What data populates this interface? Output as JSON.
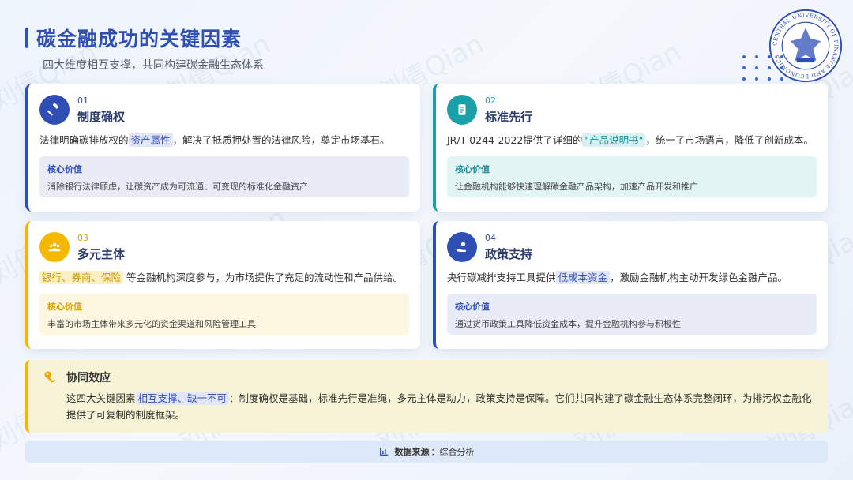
{
  "header": {
    "title": "碳金融成功的关键因素",
    "subtitle": "四大维度相互支撑，共同构建碳金融生态体系"
  },
  "watermark": "刘倩Qian",
  "colors": {
    "primary": "#2f4fb5",
    "teal": "#1aa0a8",
    "gold": "#f5b800"
  },
  "seal": {
    "ring_text": "CENTRAL UNIVERSITY OF FINANCE AND ECONOMICS"
  },
  "cards": [
    {
      "number": "01",
      "title": "制度确权",
      "icon": "gavel-icon",
      "desc_before": "法律明确碳排放权的",
      "desc_highlight": "资产属性",
      "desc_after": "，解决了抵质押处置的法律风险，奠定市场基石。",
      "value_title": "核心价值",
      "value_text": "消除银行法律顾虑，让碳资产成为可流通、可变现的标准化金融资产"
    },
    {
      "number": "02",
      "title": "标准先行",
      "icon": "document-icon",
      "desc_before": "JR/T 0244-2022提供了详细的",
      "desc_highlight": "\"产品说明书\"",
      "desc_after": "，统一了市场语言，降低了创新成本。",
      "value_title": "核心价值",
      "value_text": "让金融机构能够快速理解碳金融产品架构，加速产品开发和推广"
    },
    {
      "number": "03",
      "title": "多元主体",
      "icon": "people-icon",
      "desc_before": "",
      "desc_highlight": "银行、券商、保险",
      "desc_after": " 等金融机构深度参与，为市场提供了充足的流动性和产品供给。",
      "value_title": "核心价值",
      "value_text": "丰富的市场主体带来多元化的资金渠道和风险管理工具"
    },
    {
      "number": "04",
      "title": "政策支持",
      "icon": "hand-coin-icon",
      "desc_before": "央行碳减排支持工具提供",
      "desc_highlight": "低成本资金",
      "desc_after": "，激励金融机构主动开发绿色金融产品。",
      "value_title": "核心价值",
      "value_text": "通过货币政策工具降低资金成本，提升金融机构参与积极性"
    }
  ],
  "synergy": {
    "title": "协同效应",
    "text_before": "这四大关键因素",
    "text_highlight": "相互支撑、缺一不可",
    "text_after": "：制度确权是基础，标准先行是准绳，多元主体是动力，政策支持是保障。它们共同构建了碳金融生态体系完整闭环，为排污权金融化提供了可复制的制度框架。"
  },
  "source": {
    "label": "数据来源",
    "value": "：综合分析"
  }
}
